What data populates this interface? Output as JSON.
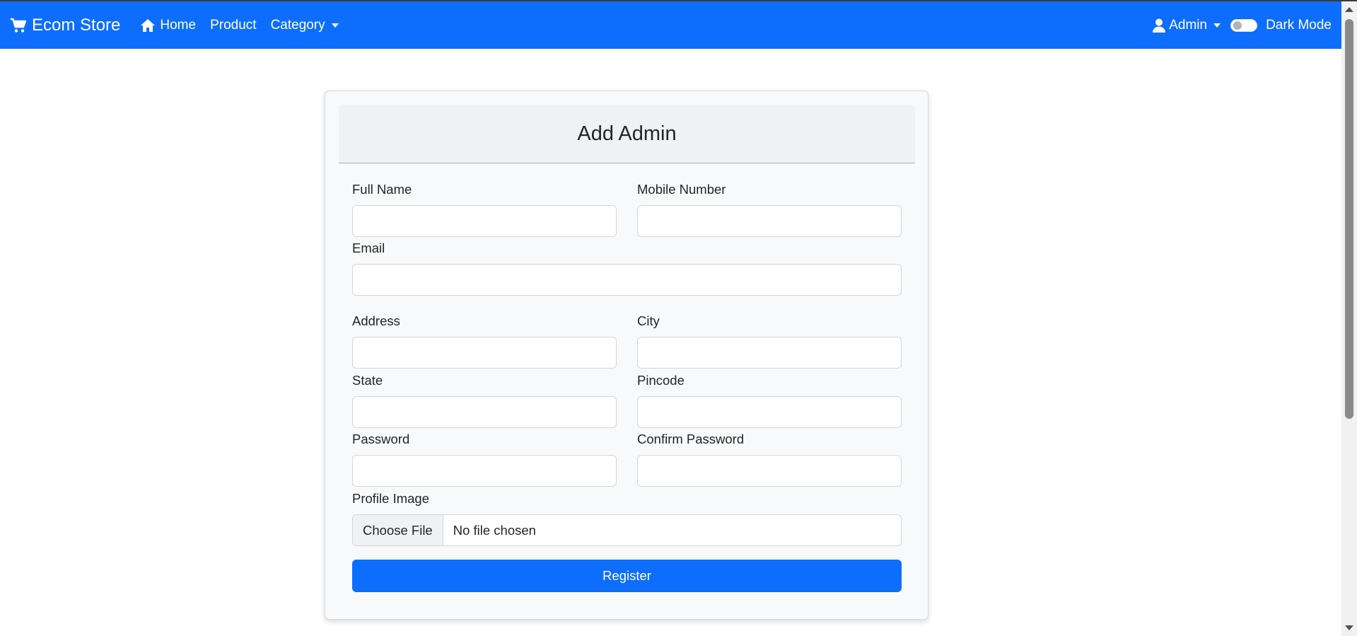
{
  "navbar": {
    "brand": "Ecom Store",
    "brand_icon": "cart-icon",
    "home": "Home",
    "home_icon": "home-icon",
    "product": "Product",
    "category": "Category",
    "admin": "Admin",
    "admin_icon": "user-icon",
    "dark_mode": "Dark Mode",
    "dark_mode_on": false,
    "color": "#0d6efd"
  },
  "form": {
    "title": "Add Admin",
    "full_name_label": "Full Name",
    "mobile_label": "Mobile Number",
    "email_label": "Email",
    "address_label": "Address",
    "city_label": "City",
    "state_label": "State",
    "pincode_label": "Pincode",
    "password_label": "Password",
    "confirm_password_label": "Confirm Password",
    "profile_image_label": "Profile Image",
    "choose_file": "Choose File",
    "no_file": "No file chosen",
    "register": "Register",
    "full_name": "",
    "mobile": "",
    "email": "",
    "address": "",
    "city": "",
    "state": "",
    "pincode": "",
    "password": "",
    "confirm_password": ""
  }
}
